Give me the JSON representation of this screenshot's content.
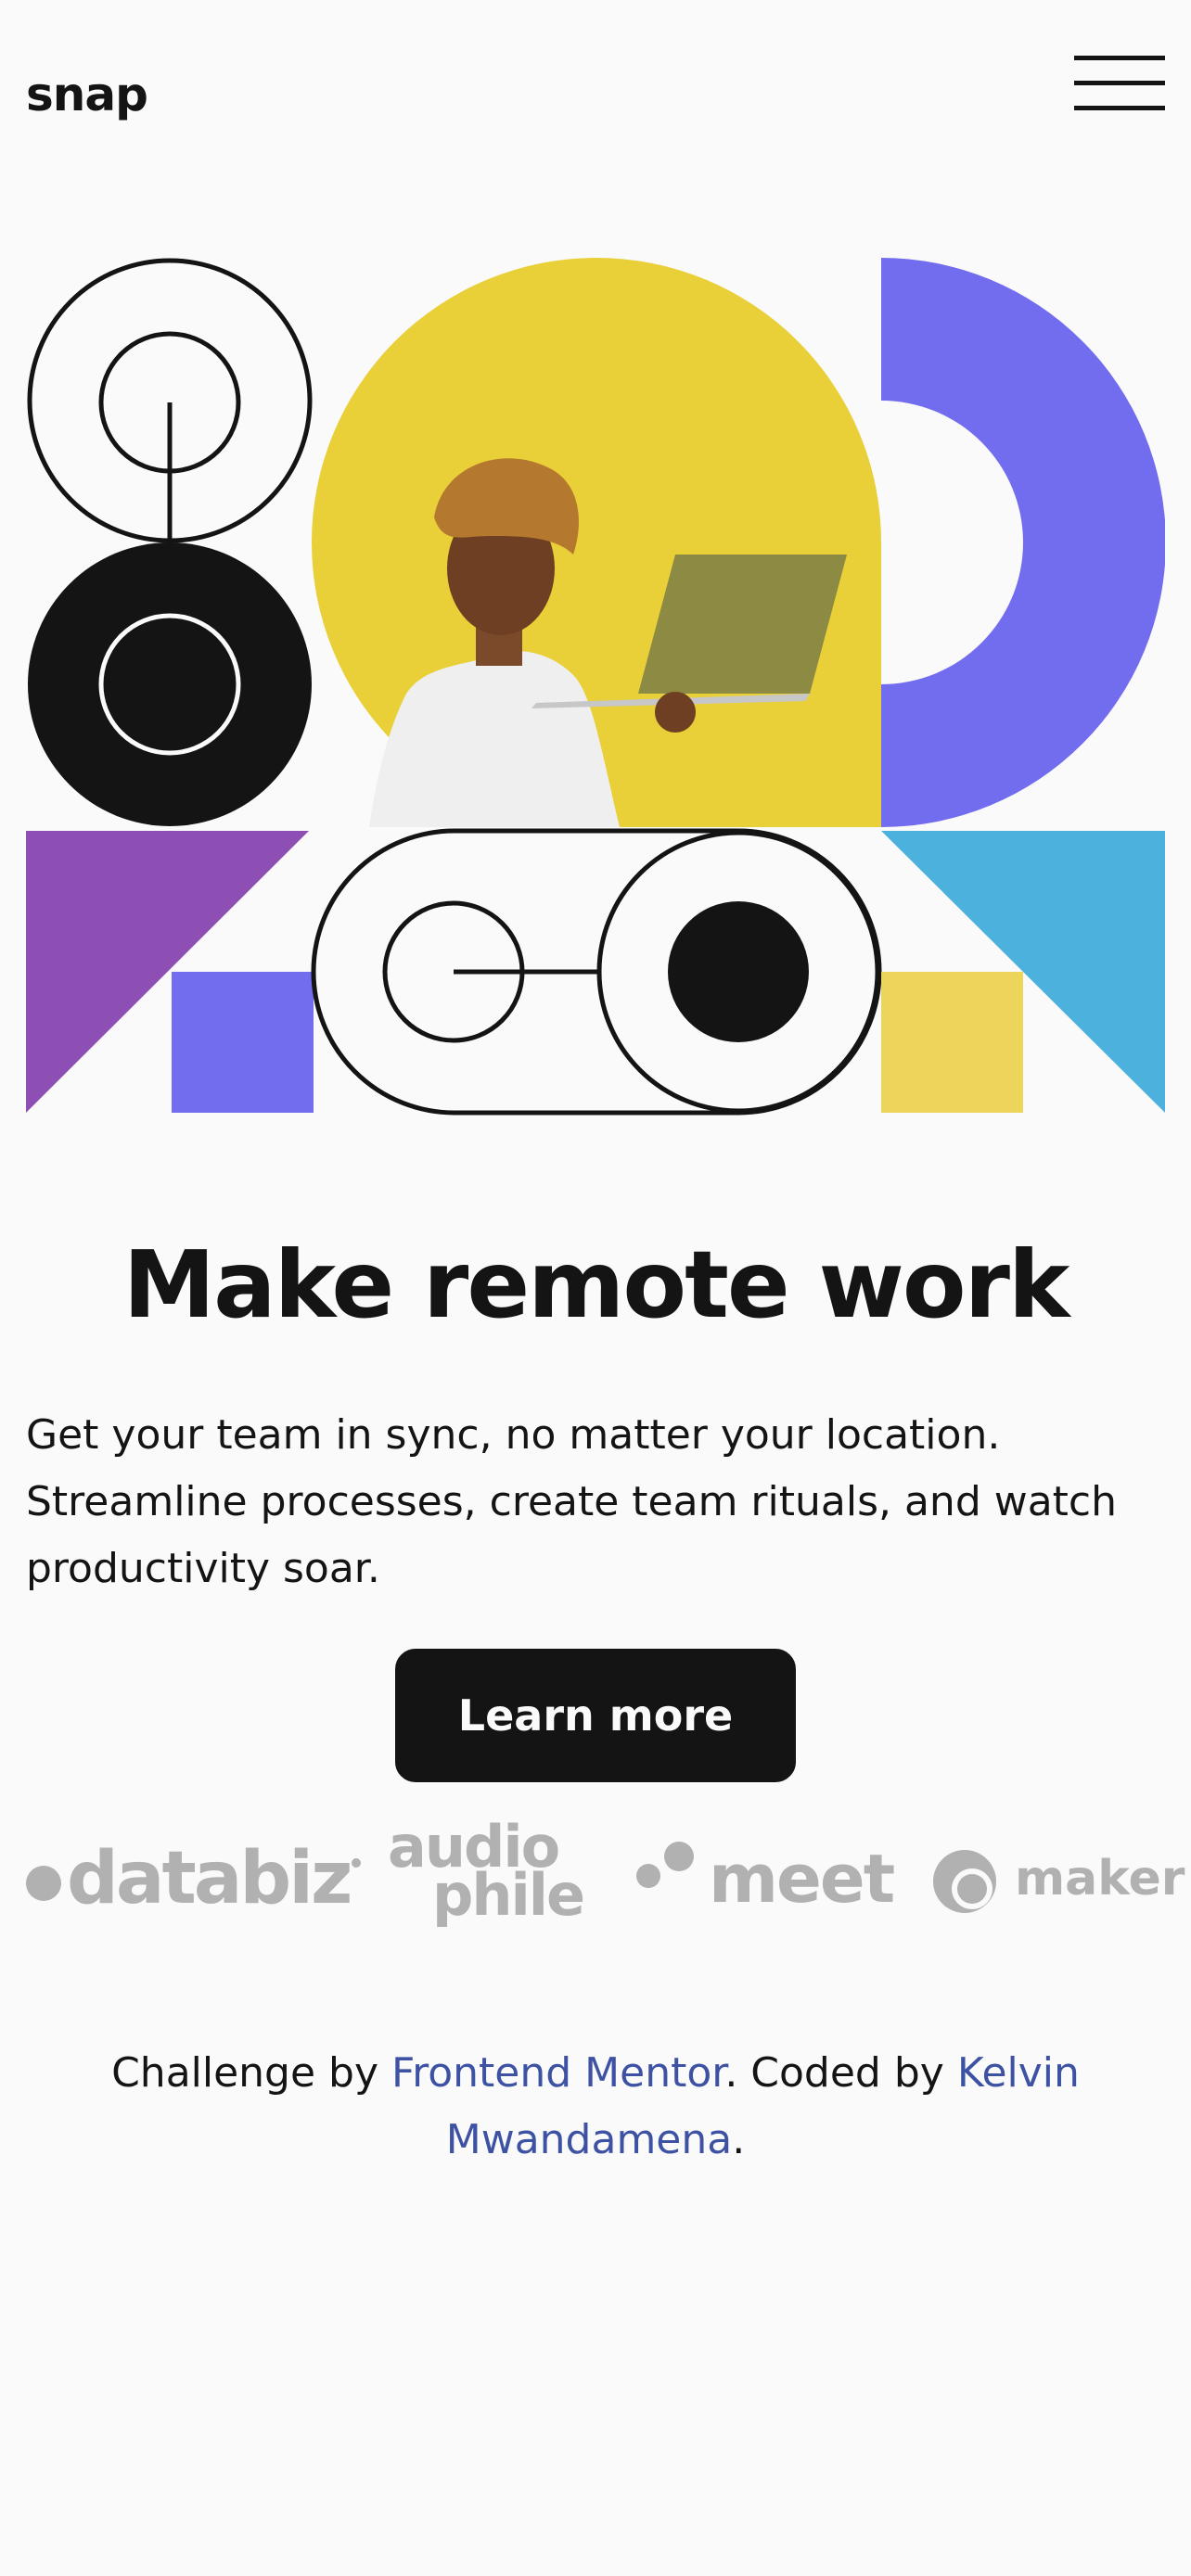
{
  "header": {
    "logo": "snap",
    "menu_icon": "hamburger-menu-icon"
  },
  "hero": {
    "image_description_icon": "person-with-laptop-illustration",
    "colors": {
      "yellow": "#e9cf38",
      "violet": "#726cef",
      "purple": "#8e4fb5",
      "cyan": "#4cb1dc",
      "pale_yellow": "#edd55c",
      "black": "#141414"
    }
  },
  "headline": "Make remote work",
  "body": "Get your team in sync, no matter your location. Streamline processes, create team rituals, and watch productivity soar.",
  "cta": {
    "label": "Learn more"
  },
  "clients": {
    "databiz": "databiz",
    "audiophile_line1": "audio",
    "audiophile_line2": "phile",
    "meet": "meet",
    "maker": "maker"
  },
  "attribution": {
    "prefix": "Challenge by ",
    "link1": "Frontend Mentor",
    "middle": ". Coded by ",
    "link2": "Kelvin Mwandamena",
    "suffix": "."
  },
  "colors": {
    "background": "#fafafa",
    "text": "#141414",
    "link": "#3e52a3",
    "logo_gray": "#b1b1b1"
  }
}
